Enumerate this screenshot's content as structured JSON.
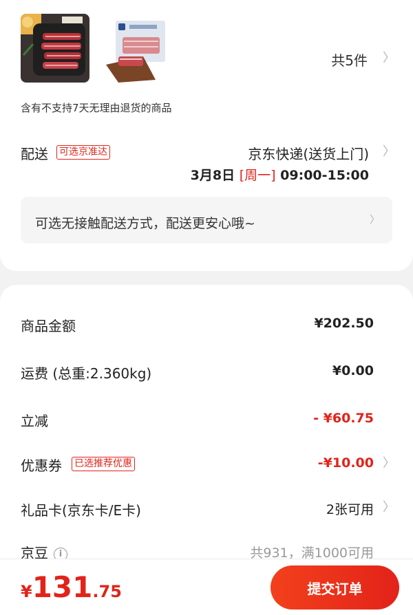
{
  "products": {
    "images": [
      "product-thumb-ribs",
      "product-thumb-beef-pack"
    ],
    "count": "共5件"
  },
  "notice": "含有不支持7天无理由退货的商品",
  "shipping": {
    "label": "配送",
    "tag": "可选京准达",
    "method": "京东快递(送货上门)",
    "date": "3月8日",
    "weekday": "[周一]",
    "time": "09:00-15:00"
  },
  "contactless": {
    "text": "可选无接触配送方式，配送更安心哦~"
  },
  "summary": {
    "goods_label": "商品金额",
    "goods_value": "¥202.50",
    "freight_label": "运费 (总重:2.360kg)",
    "freight_value": "¥0.00",
    "discount_label": "立减",
    "discount_value": "- ¥60.75",
    "coupon_label": "优惠券",
    "coupon_tag": "已选推荐优惠",
    "coupon_value": "-¥10.00",
    "giftcard_label": "礼品卡(京东卡/E卡)",
    "giftcard_value": "2张可用",
    "beans_label": "京豆",
    "beans_value": "共931，满1000可用"
  },
  "footer": {
    "currency": "¥",
    "total_int": "131",
    "total_dec": ".75",
    "submit_label": "提交订单"
  },
  "colors": {
    "accent": "#e2231a",
    "background": "#f2f2f2"
  }
}
